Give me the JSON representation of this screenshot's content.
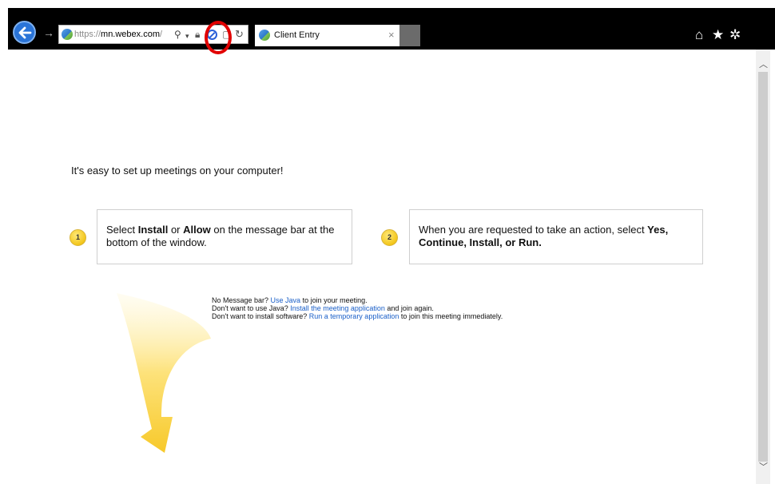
{
  "browser": {
    "url_scheme": "https://",
    "url_domain": "mn.webex.com",
    "url_rest": "/",
    "tab_title": "Client Entry",
    "tab_close": "×",
    "forward_glyph": "→",
    "icons": {
      "back": "back-arrow-icon",
      "search": "search-icon",
      "block": "blocked-content-icon",
      "refresh": "refresh-icon",
      "home": "home-icon",
      "favorites": "star-icon",
      "settings": "gear-icon"
    },
    "home_glyph": "⌂",
    "star_glyph": "★",
    "gear_glyph": "✲",
    "search_glyph": "⚲",
    "dropdown_glyph": "▾",
    "refresh_glyph": "↻",
    "highlight_color": "#e10000"
  },
  "page": {
    "headline": "It's easy to set up meetings on your computer!",
    "step1": {
      "number": "1",
      "text_pre": "Select ",
      "bold1": "Install",
      "text_mid": " or ",
      "bold2": "Allow",
      "text_post": " on the message bar at the bottom of the window."
    },
    "step2": {
      "number": "2",
      "text_pre": "When you are requested to take an action, select ",
      "bold": "Yes, Continue, Install, or Run."
    },
    "help": {
      "line1_pre": "No Message bar? ",
      "line1_link": "Use Java",
      "line1_post": " to join your meeting.",
      "line2_pre": "Don't want to use Java? ",
      "line2_link": "Install the meeting application",
      "line2_post": " and join again.",
      "line3_pre": "Don't want to install software? ",
      "line3_link": "Run a temporary application",
      "line3_post": " to join this meeting immediately."
    }
  },
  "scrollbar": {
    "up_glyph": "︿",
    "down_glyph": "﹀"
  }
}
